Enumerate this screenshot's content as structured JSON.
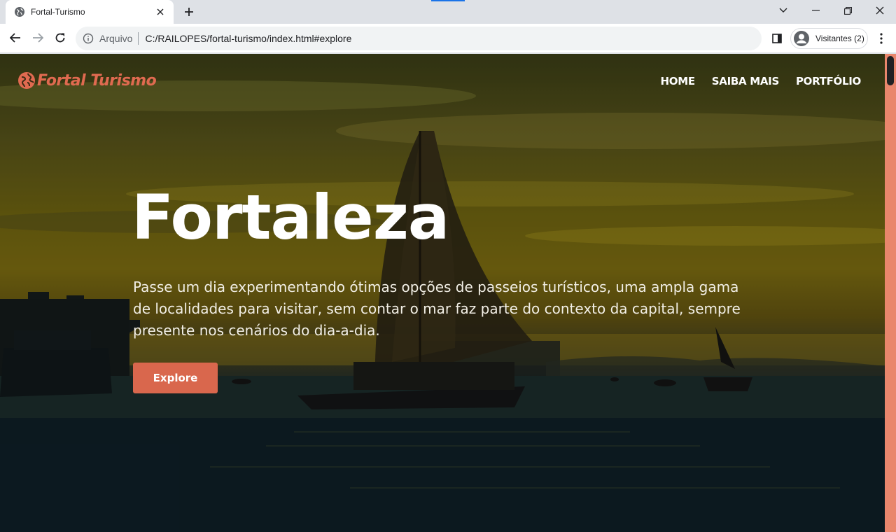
{
  "browser": {
    "tab": {
      "title": "Fortal-Turismo",
      "favicon": "globe-icon"
    },
    "new_tab_icon": "plus-icon",
    "window_controls": [
      "chevron-down-icon",
      "minimize-icon",
      "restore-icon",
      "close-icon"
    ],
    "omnibox": {
      "scheme_label": "Arquivo",
      "url": "C:/RAILOPES/fortal-turismo/index.html#explore"
    },
    "profile": {
      "label": "Visitantes (2)"
    },
    "colors": {
      "chrome_bg": "#dee1e6",
      "toolbar_bg": "#ffffff",
      "accent": "#1a73e8"
    }
  },
  "site": {
    "brand": {
      "name": "Fortal Turismo",
      "icon": "globe-icon"
    },
    "nav": [
      {
        "label": "HOME"
      },
      {
        "label": "SAIBA MAIS"
      },
      {
        "label": "PORTFÓLIO"
      }
    ],
    "hero": {
      "headline": "Fortaleza",
      "text": "Passe um dia experimentando ótimas opções de passeios turísticos, uma ampla gama de localidades para visitar, sem contar o mar faz parte do contexto da capital, sempre presente nos cenários do dia-a-dia.",
      "cta_label": "Explore"
    },
    "colors": {
      "brand": "#e06a50",
      "cta": "#d9674d",
      "scrollbar": "#e9866c"
    }
  }
}
